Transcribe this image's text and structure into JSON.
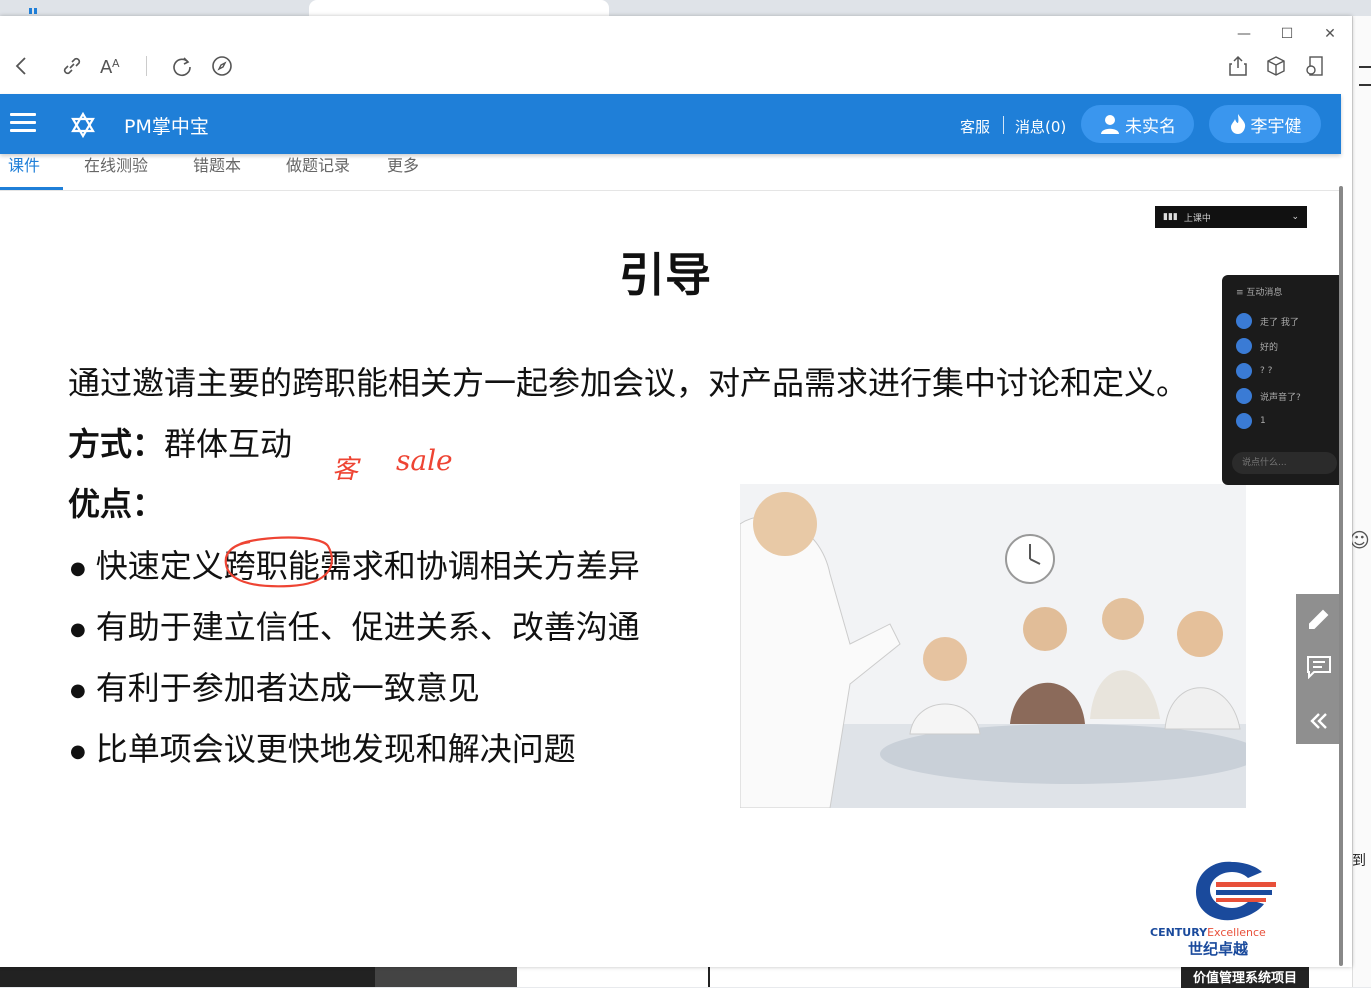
{
  "browser": {
    "window_controls": {
      "minimize": "—",
      "maximize": "☐",
      "close": "✕"
    }
  },
  "header": {
    "title": "PM掌中宝",
    "customer_service": "客服",
    "messages": "消息(0)",
    "realname_button": "未实名",
    "user_button": "李宇健",
    "brand_color": "#1f7fd8"
  },
  "tabs": [
    {
      "label": "课件",
      "active": true
    },
    {
      "label": "在线测验",
      "active": false
    },
    {
      "label": "错题本",
      "active": false
    },
    {
      "label": "做题记录",
      "active": false
    },
    {
      "label": "更多",
      "active": false
    }
  ],
  "slide": {
    "title": "引导",
    "intro": "通过邀请主要的跨职能相关方一起参加会议，对产品需求进行集中讨论和定义。",
    "method_label": "方式：",
    "method_value": "群体互动",
    "advantages_label": "优点：",
    "bullets": [
      "快速定义跨职能需求和协调相关方差异",
      "有助于建立信任、促进关系、改善沟通",
      "有利于参加者达成一致意见",
      "比单项会议更快地发现和解决问题"
    ],
    "annotation_1": "客",
    "annotation_2": "sale",
    "logo_text_en_1": "CENTURY",
    "logo_text_en_2": "Excellence",
    "logo_text_cn": "世纪卓越"
  },
  "live_panel": {
    "status": "上课中",
    "chat_title": "互动消息",
    "messages": [
      {
        "text": "走了 我了"
      },
      {
        "text": "好的"
      },
      {
        "text": "? ?"
      },
      {
        "text": "说声音了?"
      },
      {
        "text": "1"
      }
    ],
    "input_placeholder": "说点什么..."
  },
  "side_tools": [
    "pencil-icon",
    "comment-icon",
    "collapse-icon"
  ],
  "taskbar": {
    "label": "价值管理系统项目"
  }
}
